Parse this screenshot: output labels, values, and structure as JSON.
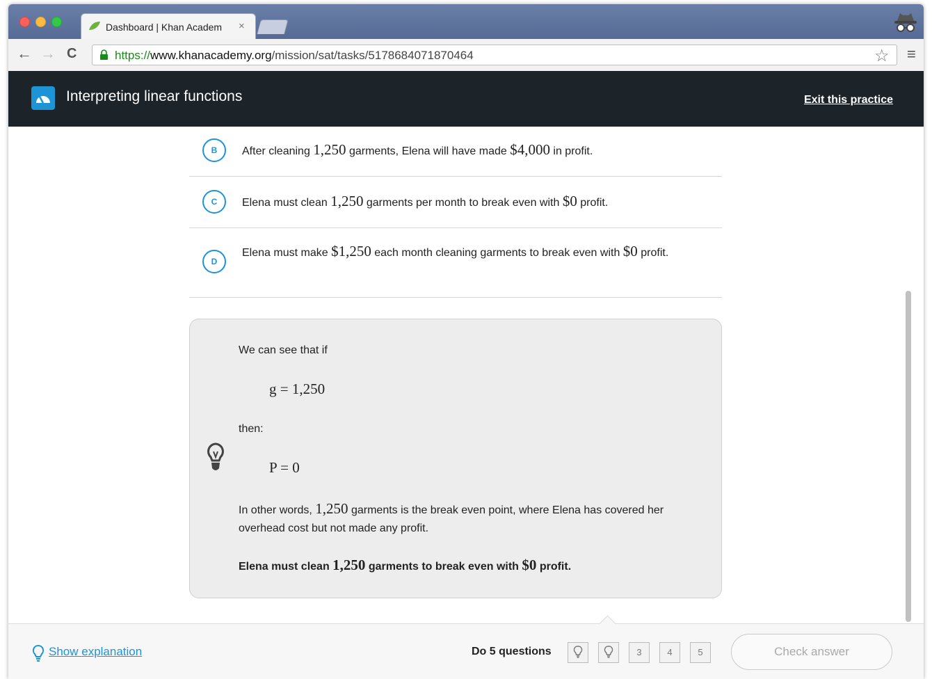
{
  "browser": {
    "tab_title": "Dashboard | Khan Academ",
    "tab_close": "×",
    "url_scheme": "https://",
    "url_host": "www.khanacademy.org",
    "url_path": "/mission/sat/tasks/5178684071870464"
  },
  "header": {
    "title": "Interpreting linear functions",
    "exit_label": "Exit this practice"
  },
  "choices": [
    {
      "letter": "B",
      "t1": "After cleaning ",
      "m1": "1,250",
      "t2": " garments, Elena will have made ",
      "m2": "$4,000",
      "t3": " in profit."
    },
    {
      "letter": "C",
      "t1": "Elena must clean ",
      "m1": "1,250",
      "t2": " garments per month to break even with ",
      "m2": "$0",
      "t3": " profit."
    },
    {
      "letter": "D",
      "t1": "Elena must make ",
      "m1": "$1,250",
      "t2": " each month cleaning garments to break even with ",
      "m2": "$0",
      "t3": " profit."
    }
  ],
  "hint": {
    "intro": "We can see that if",
    "eq1": "g = 1,250",
    "then": "then:",
    "eq2": "P = 0",
    "p1_a": "In other words, ",
    "p1_m": "1,250",
    "p1_b": " garments is the break even point, where Elena has covered her overhead cost but not made any profit.",
    "p2_a": "Elena must clean ",
    "p2_m1": "1,250",
    "p2_b": " garments to break even with ",
    "p2_m2": "$0",
    "p2_c": " profit."
  },
  "footer": {
    "show_explanation": "Show explanation",
    "do_questions": "Do 5 questions",
    "questions": [
      "3",
      "4",
      "5"
    ],
    "check_answer": "Check answer"
  },
  "colors": {
    "accent": "#1c94d6",
    "header_bg": "#1c2329"
  }
}
